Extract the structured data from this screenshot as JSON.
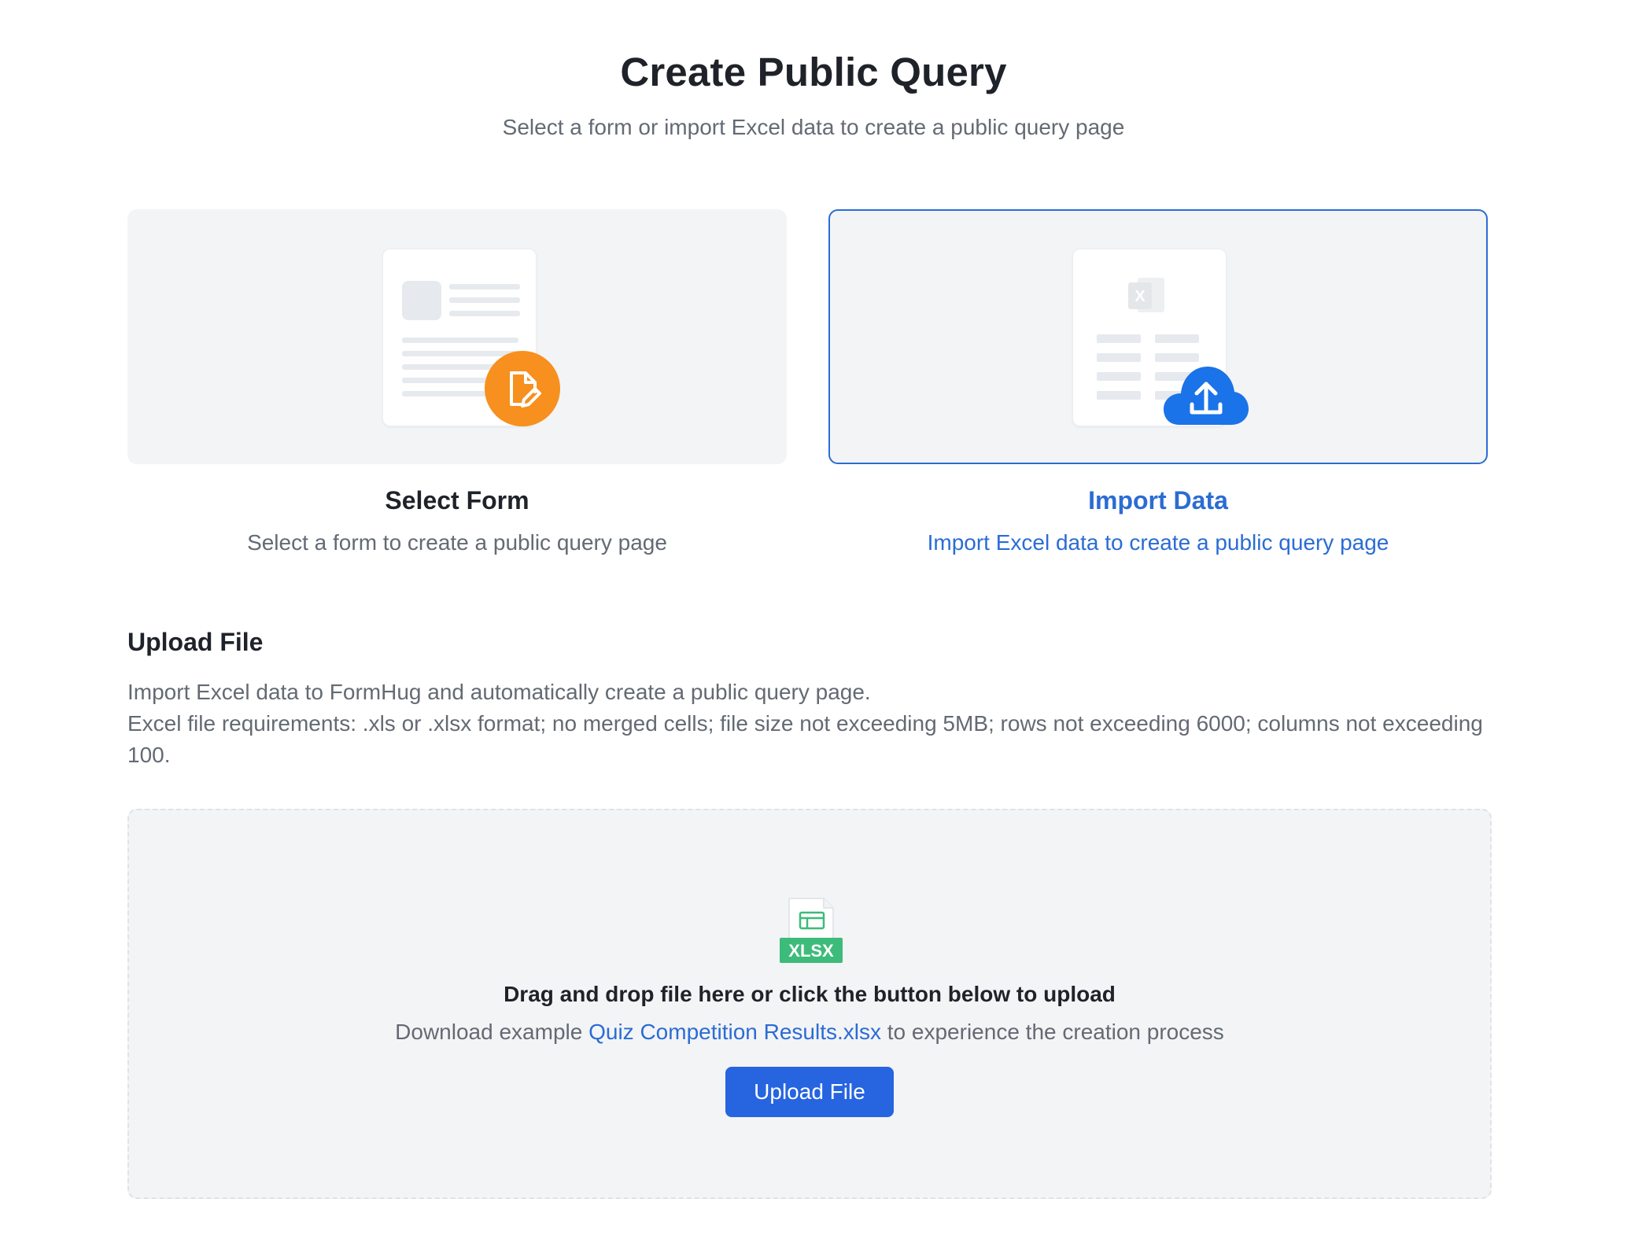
{
  "header": {
    "title": "Create Public Query",
    "subtitle": "Select a form or import Excel data to create a public query page"
  },
  "options": {
    "select_form": {
      "title": "Select Form",
      "description": "Select a form to create a public query page",
      "badge_icon": "file-edit-icon",
      "badge_color": "#f7901e"
    },
    "import_data": {
      "title": "Import Data",
      "description": "Import Excel data to create a public query page",
      "badge_icon": "cloud-upload-icon",
      "badge_color": "#1a73e8",
      "selected": true
    }
  },
  "upload": {
    "section_title": "Upload File",
    "description_line1": "Import Excel data to FormHug and automatically create a public query page.",
    "description_line2": "Excel file requirements: .xls or .xlsx format; no merged cells; file size not exceeding 5MB; rows not exceeding 6000; columns not exceeding 100.",
    "dropzone": {
      "file_badge": "XLSX",
      "title": "Drag and drop file here or click the button below to upload",
      "hint_prefix": "Download example ",
      "hint_link": "Quiz Competition Results.xlsx",
      "hint_suffix": " to experience the creation process",
      "button_label": "Upload File"
    }
  },
  "colors": {
    "accent": "#2b6cd4",
    "button": "#2664e0",
    "xlsx_green": "#3dbb7a"
  }
}
